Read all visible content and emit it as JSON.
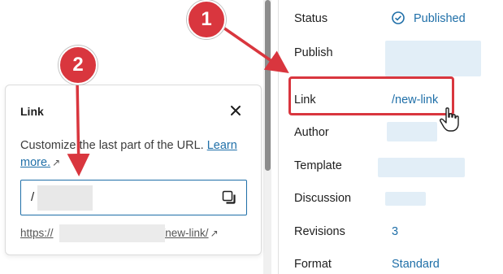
{
  "sidebar": {
    "rows": {
      "status": {
        "label": "Status",
        "value": "Published"
      },
      "publish": {
        "label": "Publish"
      },
      "link": {
        "label": "Link",
        "value": "/new-link"
      },
      "author": {
        "label": "Author"
      },
      "template": {
        "label": "Template"
      },
      "discussion": {
        "label": "Discussion"
      },
      "revisions": {
        "label": "Revisions",
        "value": "3"
      },
      "format": {
        "label": "Format",
        "value": "Standard"
      }
    }
  },
  "popover": {
    "title": "Link",
    "description": "Customize the last part of the URL.",
    "learn_more": "Learn more.",
    "slug_prefix": "/",
    "permalink_prefix": "https://",
    "permalink_suffix": "/new-link/"
  },
  "annotations": {
    "badge_1": "1",
    "badge_2": "2"
  },
  "colors": {
    "accent": "#1f6fa8",
    "annotation": "#d9363e"
  }
}
